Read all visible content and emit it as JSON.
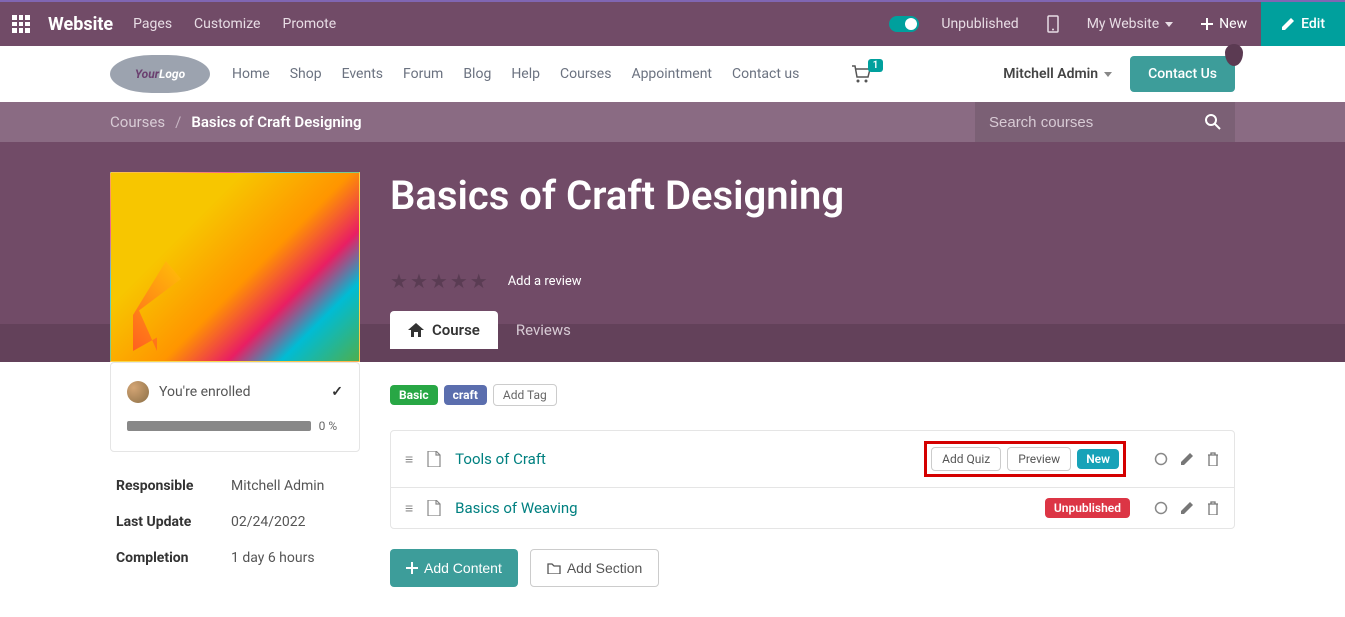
{
  "admin": {
    "brand": "Website",
    "links": [
      "Pages",
      "Customize",
      "Promote"
    ],
    "publish_status": "Unpublished",
    "my_site": "My Website",
    "new": "New",
    "edit": "Edit"
  },
  "site": {
    "logo_your": "Your",
    "logo_logo": "Logo",
    "nav": [
      "Home",
      "Shop",
      "Events",
      "Forum",
      "Blog",
      "Help",
      "Courses",
      "Appointment",
      "Contact us"
    ],
    "cart_count": "1",
    "user": "Mitchell Admin",
    "contact": "Contact Us"
  },
  "breadcrumb": {
    "root": "Courses",
    "current": "Basics of Craft Designing",
    "search_placeholder": "Search courses"
  },
  "hero": {
    "title": "Basics of Craft Designing",
    "add_review": "Add a review",
    "tab_course": "Course",
    "tab_reviews": "Reviews"
  },
  "sidebar": {
    "enrolled": "You're enrolled",
    "progress": "0 %",
    "details": [
      {
        "label": "Responsible",
        "value": "Mitchell Admin"
      },
      {
        "label": "Last Update",
        "value": "02/24/2022"
      },
      {
        "label": "Completion",
        "value": "1 day 6 hours"
      }
    ]
  },
  "content": {
    "tags": [
      {
        "text": "Basic",
        "cls": "basic"
      },
      {
        "text": "craft",
        "cls": "craft"
      }
    ],
    "add_tag": "Add Tag",
    "items": [
      {
        "title": "Tools of Craft",
        "add_quiz": "Add Quiz",
        "preview": "Preview",
        "badge": "New",
        "highlighted": true
      },
      {
        "title": "Basics of Weaving",
        "badge": "Unpublished"
      }
    ],
    "add_content": "Add Content",
    "add_section": "Add Section"
  }
}
